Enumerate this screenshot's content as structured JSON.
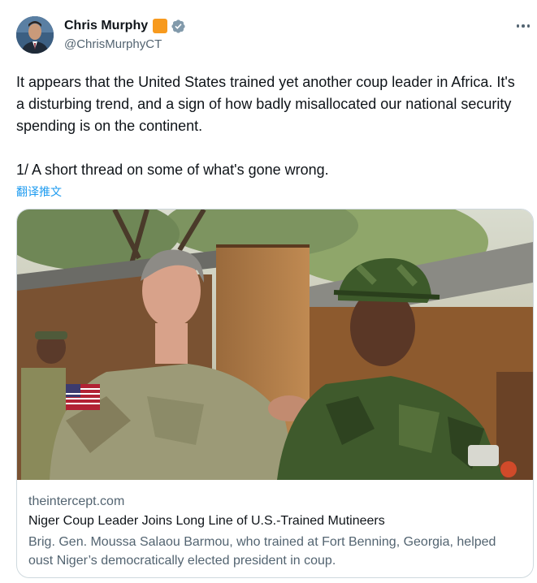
{
  "author": {
    "display_name": "Chris Murphy",
    "handle": "@ChrisMurphyCT",
    "avatar_icon": "user-avatar",
    "org_badge_color": "#f79a1e",
    "verified_color": "#829aab"
  },
  "tweet": {
    "text": "It appears that the United States trained yet another coup leader in Africa. It's a disturbing trend, and a sign of how badly misallocated our national security spending is on the continent.\n\n1/ A short thread on some of what's gone wrong.",
    "translate_label": "翻译推文"
  },
  "link_card": {
    "image_icon": "article-photo",
    "domain": "theintercept.com",
    "headline": "Niger Coup Leader Joins Long Line of U.S.-Trained Mutineers",
    "description": "Brig. Gen. Moussa Salaou Barmou, who trained at Fort Benning, Georgia, helped oust Niger’s democratically elected president in coup."
  },
  "colors": {
    "link": "#1d9bf0",
    "secondary_text": "#536471",
    "border": "#cfd9de"
  }
}
